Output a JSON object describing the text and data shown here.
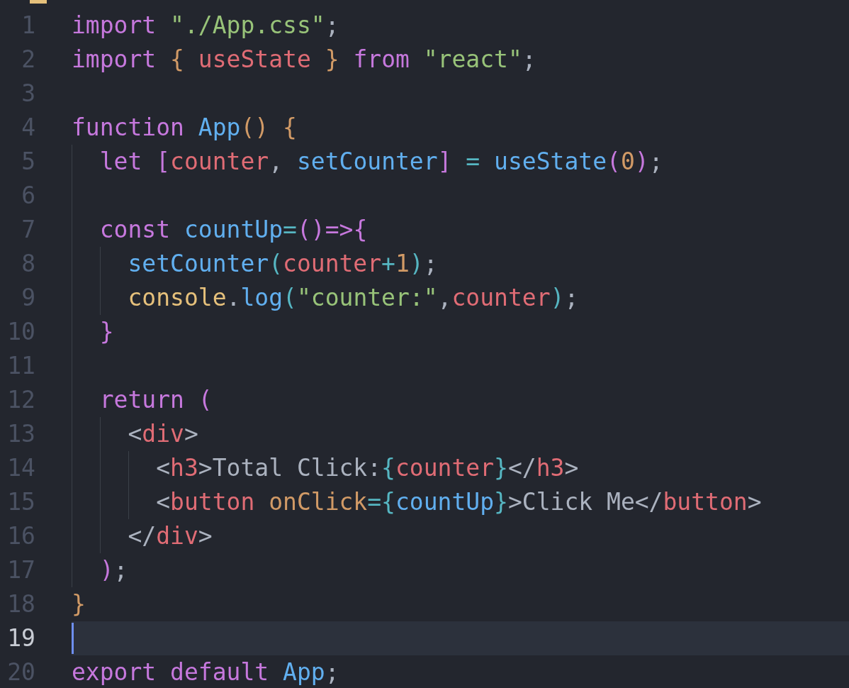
{
  "lines": [
    {
      "number": "1",
      "active": false,
      "tokens": [
        {
          "text": "import ",
          "kind": "keyword"
        },
        {
          "text": "\"./App.css\"",
          "kind": "string"
        },
        {
          "text": ";",
          "kind": "plain"
        }
      ]
    },
    {
      "number": "2",
      "active": false,
      "tokens": [
        {
          "text": "import ",
          "kind": "keyword"
        },
        {
          "text": "{ ",
          "kind": "gold"
        },
        {
          "text": "useState ",
          "kind": "variable"
        },
        {
          "text": "} ",
          "kind": "gold"
        },
        {
          "text": "from ",
          "kind": "keyword"
        },
        {
          "text": "\"react\"",
          "kind": "string"
        },
        {
          "text": ";",
          "kind": "plain"
        }
      ]
    },
    {
      "number": "3",
      "active": false
    },
    {
      "number": "4",
      "active": false,
      "tokens": [
        {
          "text": "function ",
          "kind": "keyword"
        },
        {
          "text": "App",
          "kind": "function"
        },
        {
          "text": "() {",
          "kind": "gold"
        }
      ]
    },
    {
      "number": "5",
      "active": false,
      "tokens": [
        {
          "text": "  let ",
          "kind": "keyword"
        },
        {
          "text": "[",
          "kind": "purple"
        },
        {
          "text": "counter",
          "kind": "variable"
        },
        {
          "text": ", ",
          "kind": "plain"
        },
        {
          "text": "setCounter",
          "kind": "function"
        },
        {
          "text": "] ",
          "kind": "purple"
        },
        {
          "text": "= ",
          "kind": "teal"
        },
        {
          "text": "useState",
          "kind": "function"
        },
        {
          "text": "(",
          "kind": "purple"
        },
        {
          "text": "0",
          "kind": "number"
        },
        {
          "text": ")",
          "kind": "purple"
        },
        {
          "text": ";",
          "kind": "plain"
        }
      ]
    },
    {
      "number": "6",
      "active": false
    },
    {
      "number": "7",
      "active": false,
      "tokens": [
        {
          "text": "  const ",
          "kind": "keyword"
        },
        {
          "text": "countUp",
          "kind": "function"
        },
        {
          "text": "=",
          "kind": "teal"
        },
        {
          "text": "()=>{",
          "kind": "purple"
        }
      ]
    },
    {
      "number": "8",
      "active": false,
      "tokens": [
        {
          "text": "    setCounter",
          "kind": "function"
        },
        {
          "text": "(",
          "kind": "teal"
        },
        {
          "text": "counter",
          "kind": "variable"
        },
        {
          "text": "+",
          "kind": "teal"
        },
        {
          "text": "1",
          "kind": "number"
        },
        {
          "text": ")",
          "kind": "teal"
        },
        {
          "text": ";",
          "kind": "plain"
        }
      ]
    },
    {
      "number": "9",
      "active": false,
      "tokens": [
        {
          "text": "    console",
          "kind": "object"
        },
        {
          "text": ".",
          "kind": "plain"
        },
        {
          "text": "log",
          "kind": "function"
        },
        {
          "text": "(",
          "kind": "teal"
        },
        {
          "text": "\"counter:\"",
          "kind": "string"
        },
        {
          "text": ",",
          "kind": "plain"
        },
        {
          "text": "counter",
          "kind": "variable"
        },
        {
          "text": ")",
          "kind": "teal"
        },
        {
          "text": ";",
          "kind": "plain"
        }
      ]
    },
    {
      "number": "10",
      "active": false,
      "tokens": [
        {
          "text": "  }",
          "kind": "purple"
        }
      ]
    },
    {
      "number": "11",
      "active": false
    },
    {
      "number": "12",
      "active": false,
      "tokens": [
        {
          "text": "  return ",
          "kind": "keyword"
        },
        {
          "text": "(",
          "kind": "purple"
        }
      ]
    },
    {
      "number": "13",
      "active": false,
      "tokens": [
        {
          "text": "    <",
          "kind": "plain"
        },
        {
          "text": "div",
          "kind": "variable"
        },
        {
          "text": ">",
          "kind": "plain"
        }
      ]
    },
    {
      "number": "14",
      "active": false,
      "tokens": [
        {
          "text": "      <",
          "kind": "plain"
        },
        {
          "text": "h3",
          "kind": "variable"
        },
        {
          "text": ">Total Click:",
          "kind": "plain"
        },
        {
          "text": "{",
          "kind": "teal"
        },
        {
          "text": "counter",
          "kind": "variable"
        },
        {
          "text": "}",
          "kind": "teal"
        },
        {
          "text": "</",
          "kind": "plain"
        },
        {
          "text": "h3",
          "kind": "variable"
        },
        {
          "text": ">",
          "kind": "plain"
        }
      ]
    },
    {
      "number": "15",
      "active": false,
      "tokens": [
        {
          "text": "      <",
          "kind": "plain"
        },
        {
          "text": "button ",
          "kind": "variable"
        },
        {
          "text": "onClick",
          "kind": "attribute"
        },
        {
          "text": "={",
          "kind": "teal"
        },
        {
          "text": "countUp",
          "kind": "function"
        },
        {
          "text": "}",
          "kind": "teal"
        },
        {
          "text": ">Click Me</",
          "kind": "plain"
        },
        {
          "text": "button",
          "kind": "variable"
        },
        {
          "text": ">",
          "kind": "plain"
        }
      ]
    },
    {
      "number": "16",
      "active": false,
      "tokens": [
        {
          "text": "    </",
          "kind": "plain"
        },
        {
          "text": "div",
          "kind": "variable"
        },
        {
          "text": ">",
          "kind": "plain"
        }
      ]
    },
    {
      "number": "17",
      "active": false,
      "tokens": [
        {
          "text": "  )",
          "kind": "purple"
        },
        {
          "text": ";",
          "kind": "plain"
        }
      ]
    },
    {
      "number": "18",
      "active": false,
      "tokens": [
        {
          "text": "}",
          "kind": "gold"
        }
      ]
    },
    {
      "number": "19",
      "active": true
    },
    {
      "number": "20",
      "active": false,
      "tokens": [
        {
          "text": "export default ",
          "kind": "keyword"
        },
        {
          "text": "App",
          "kind": "function"
        },
        {
          "text": ";",
          "kind": "plain"
        }
      ]
    }
  ]
}
